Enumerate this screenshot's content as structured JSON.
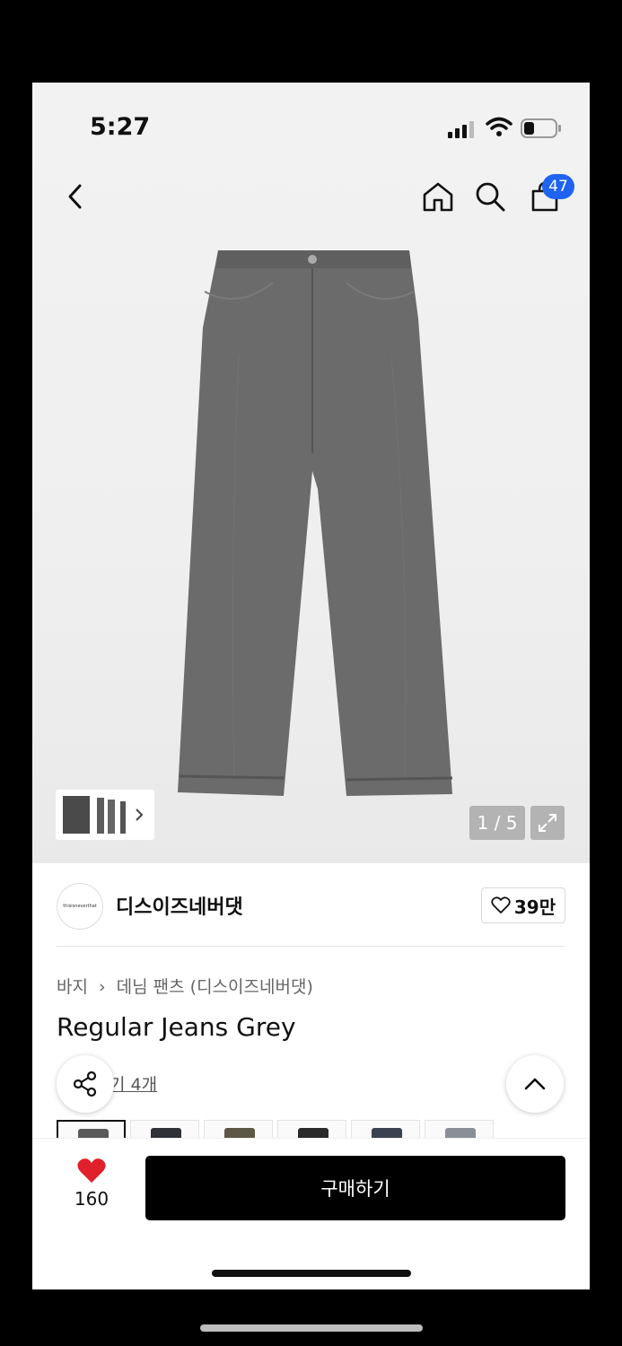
{
  "status_bar": {
    "time": "5:27"
  },
  "nav": {
    "cart_count": "47"
  },
  "gallery": {
    "counter": "1 / 5"
  },
  "brand": {
    "name": "디스이즈네버댓",
    "logo_text": "thisisneverthat",
    "likes": "39만"
  },
  "product": {
    "breadcrumb": [
      "바지",
      "데님 팬츠 (디스이즈네버댓)"
    ],
    "title": "Regular Jeans Grey",
    "review_link": "기 4개"
  },
  "color_swatches": [
    "#5a5a5a",
    "#2f3338",
    "#5d5745",
    "#2a2a2a",
    "#3a4150",
    "#8a8f97"
  ],
  "bottom_bar": {
    "like_count": "160",
    "buy_label": "구매하기"
  },
  "colors": {
    "accent_badge": "#1f63f0",
    "heart": "#e0202b",
    "buy_button": "#000000"
  }
}
